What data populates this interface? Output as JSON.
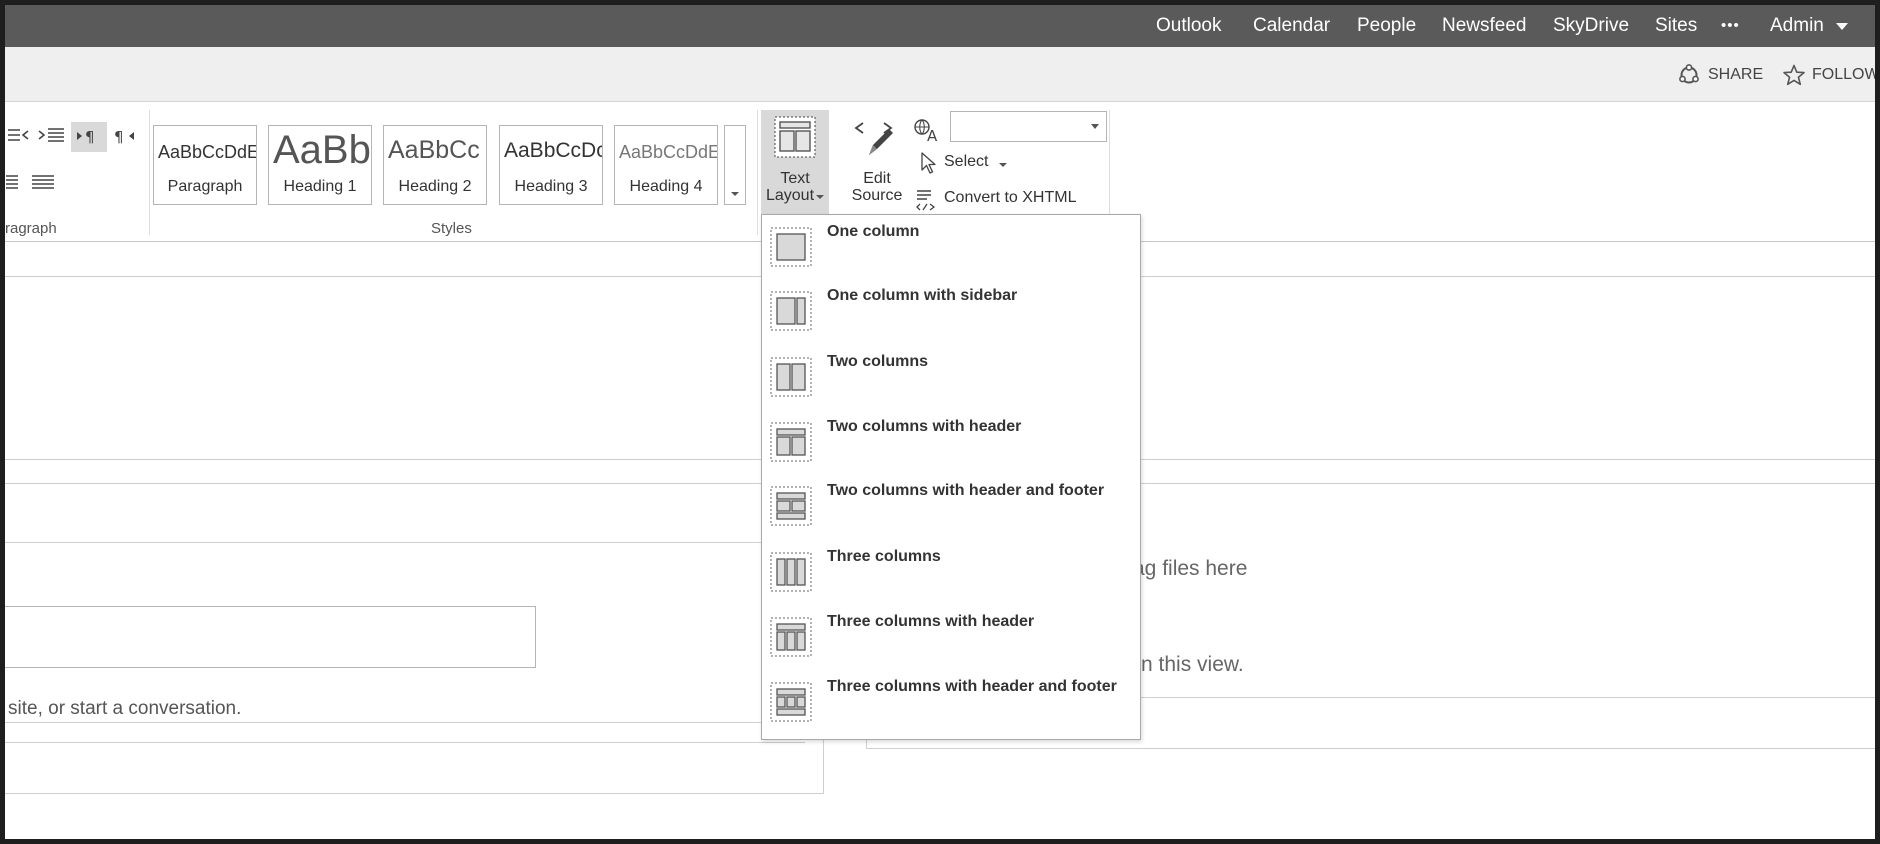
{
  "suite_nav": {
    "items": [
      "Outlook",
      "Calendar",
      "People",
      "Newsfeed",
      "SkyDrive",
      "Sites"
    ],
    "more": "•••",
    "user": "Admin"
  },
  "share_bar": {
    "share": "SHARE",
    "follow": "FOLLOW"
  },
  "ribbon": {
    "paragraph_group_label": "ragraph",
    "styles_group_label": "Styles",
    "styles": [
      {
        "sample": "AaBbCcDdEe",
        "label": "Paragraph"
      },
      {
        "sample": "AaBb",
        "label": "Heading 1"
      },
      {
        "sample": "AaBbCc",
        "label": "Heading 2"
      },
      {
        "sample": "AaBbCcDc",
        "label": "Heading 3"
      },
      {
        "sample": "AaBbCcDdE",
        "label": "Heading 4"
      }
    ],
    "text_layout": {
      "line1": "Text",
      "line2": "Layout"
    },
    "edit_source": {
      "line1": "Edit",
      "line2": "Source"
    },
    "language_select_value": "",
    "select_label": "Select",
    "convert_label": "Convert to XHTML"
  },
  "page_body": {
    "drag_files": "ag files here",
    "no_items": "s in this view.",
    "conversation": "site, or start a conversation."
  },
  "text_layout_menu": {
    "items": [
      {
        "label": "One column",
        "icon": "one-column-icon"
      },
      {
        "label": "One column with sidebar",
        "icon": "one-column-sidebar-icon"
      },
      {
        "label": "Two columns",
        "icon": "two-columns-icon"
      },
      {
        "label": "Two columns with header",
        "icon": "two-columns-header-icon"
      },
      {
        "label": "Two columns with header and footer",
        "icon": "two-columns-header-footer-icon"
      },
      {
        "label": "Three columns",
        "icon": "three-columns-icon"
      },
      {
        "label": "Three columns with header",
        "icon": "three-columns-header-icon"
      },
      {
        "label": "Three columns with header and footer",
        "icon": "three-columns-header-footer-icon"
      }
    ]
  }
}
